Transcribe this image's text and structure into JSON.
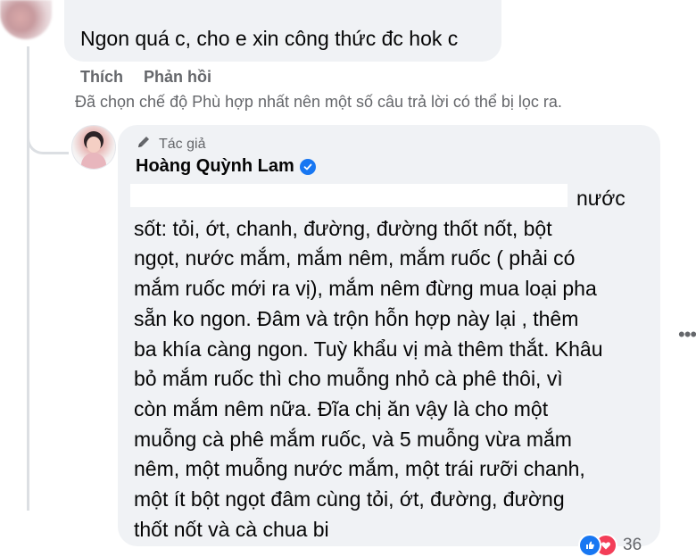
{
  "first_comment": {
    "text": "Ngon quá c, cho e xin công thức đc hok c"
  },
  "actions": {
    "like": "Thích",
    "reply": "Phản hồi"
  },
  "filter_note": "Đã chọn chế độ Phù hợp nhất nên một số câu trả lời có thể bị lọc ra.",
  "reply_comment": {
    "author_tag": "Tác giả",
    "author_name": "Hoàng Quỳnh Lam",
    "lines": [
      "nước",
      "sốt: tỏi, ớt, chanh, đường, đường thốt nốt, bột",
      "ngọt, nước mắm, mắm nêm, mắm ruốc ( phải có",
      "mắm ruốc mới ra vị), mắm nêm đừng mua loại pha",
      "sẵn ko ngon. Đâm và trộn hỗn hợp này lại , thêm",
      "ba khía càng ngon. Tuỳ khẩu vị mà thêm thắt. Khâu",
      "bỏ mắm ruốc thì cho muỗng nhỏ cà phê thôi, vì",
      "còn mắm nêm nữa. Đĩa chị ăn vậy là cho một",
      "muỗng cà phê mắm ruốc, và 5 muỗng vừa mắm",
      "nêm, một muỗng nước mắm, một trái rưỡi chanh,",
      "một ít bột ngọt đâm cùng tỏi, ớt, đường, đường",
      "thốt nốt và cà chua bi"
    ],
    "reaction_count": "36"
  },
  "colors": {
    "bubble": "#f0f2f5",
    "secondary_text": "#65676b",
    "verified_blue": "#1877f2",
    "love_red": "#f33e58"
  }
}
